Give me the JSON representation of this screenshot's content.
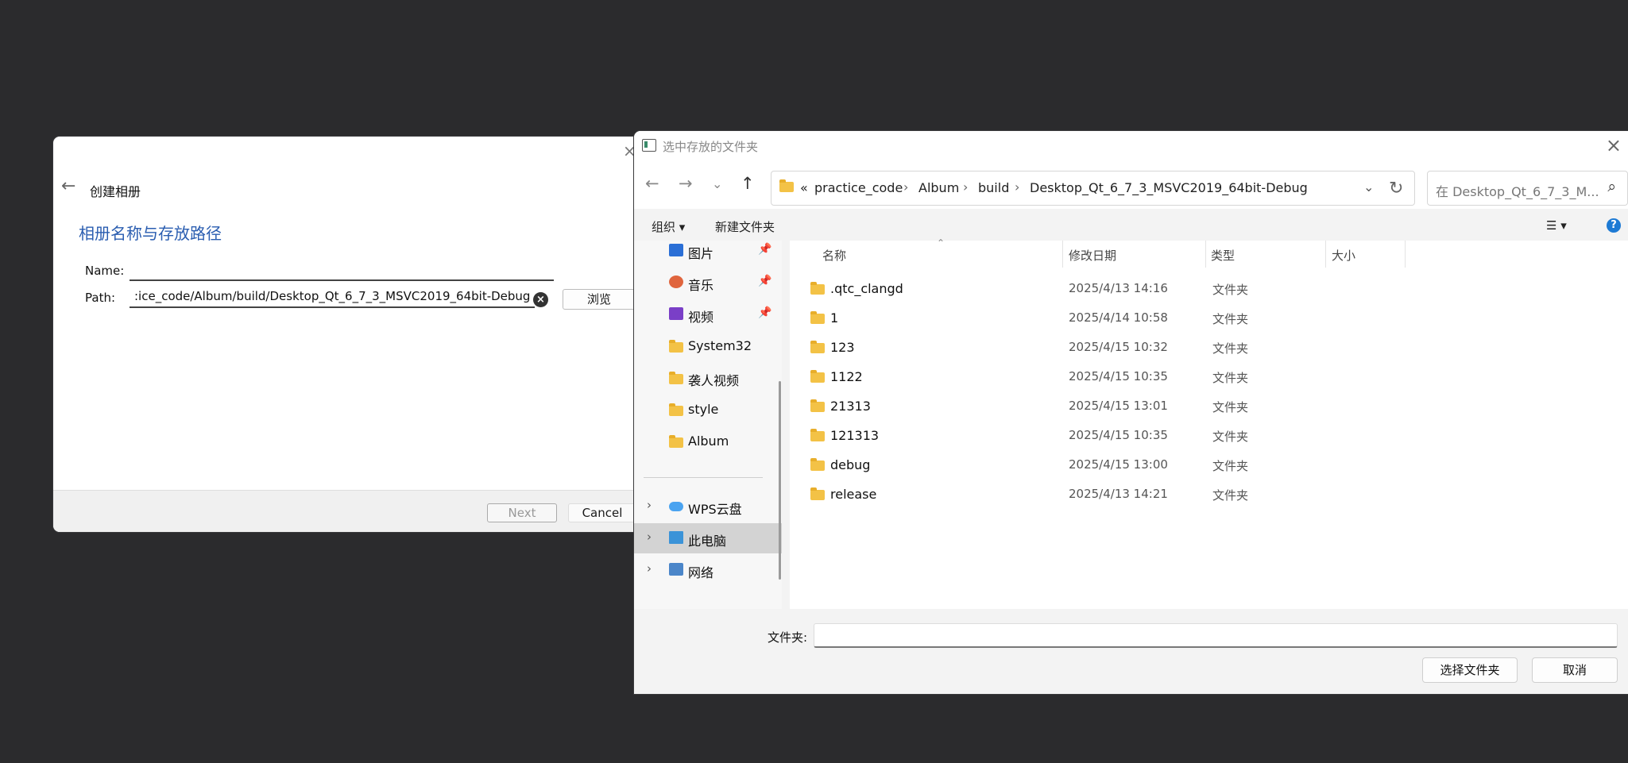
{
  "wizard": {
    "title": "创建相册",
    "heading": "相册名称与存放路径",
    "name_label": "Name:",
    "name_value": "",
    "path_label": "Path:",
    "path_value": ":ice_code/Album/build/Desktop_Qt_6_7_3_MSVC2019_64bit-Debug",
    "browse_label": "浏览",
    "next_label": "Next",
    "cancel_label": "Cancel",
    "close_glyph": "×",
    "back_glyph": "←"
  },
  "dialog": {
    "title": "选中存放的文件夹",
    "breadcrumbs": [
      "«",
      "practice_code",
      "Album",
      "build",
      "Desktop_Qt_6_7_3_MSVC2019_64bit-Debug"
    ],
    "search_placeholder": "在 Desktop_Qt_6_7_3_M...",
    "toolbar": {
      "organize": "组织 ▾",
      "new_folder": "新建文件夹",
      "view": "☰ ▾",
      "help": "?"
    },
    "sidebar": [
      {
        "label": "图片",
        "icon": "pictures-icon",
        "pinned": true
      },
      {
        "label": "音乐",
        "icon": "music-icon",
        "pinned": true
      },
      {
        "label": "视频",
        "icon": "videos-icon",
        "pinned": true
      },
      {
        "label": "System32",
        "icon": "folder-icon",
        "pinned": false
      },
      {
        "label": "袭人视频",
        "icon": "folder-icon",
        "pinned": false
      },
      {
        "label": "style",
        "icon": "folder-icon",
        "pinned": false
      },
      {
        "label": "Album",
        "icon": "folder-icon",
        "pinned": false
      }
    ],
    "sidebar_tree": [
      {
        "label": "WPS云盘",
        "icon": "cloud-icon",
        "selected": false
      },
      {
        "label": "此电脑",
        "icon": "computer-icon",
        "selected": true
      },
      {
        "label": "网络",
        "icon": "network-icon",
        "selected": false
      }
    ],
    "columns": {
      "name": "名称",
      "date": "修改日期",
      "type": "类型",
      "size": "大小"
    },
    "files": [
      {
        "name": ".qtc_clangd",
        "date": "2025/4/13 14:16",
        "type": "文件夹"
      },
      {
        "name": "1",
        "date": "2025/4/14 10:58",
        "type": "文件夹"
      },
      {
        "name": "123",
        "date": "2025/4/15 10:32",
        "type": "文件夹"
      },
      {
        "name": "1122",
        "date": "2025/4/15 10:35",
        "type": "文件夹"
      },
      {
        "name": "21313",
        "date": "2025/4/15 13:01",
        "type": "文件夹"
      },
      {
        "name": "121313",
        "date": "2025/4/15 10:35",
        "type": "文件夹"
      },
      {
        "name": "debug",
        "date": "2025/4/15 13:00",
        "type": "文件夹"
      },
      {
        "name": "release",
        "date": "2025/4/13 14:21",
        "type": "文件夹"
      }
    ],
    "folder_label": "文件夹:",
    "folder_value": "",
    "select_label": "选择文件夹",
    "cancel_label": "取消"
  },
  "colors": {
    "heading_blue": "#2a5db0",
    "folder_yellow": "#f3c246",
    "help_blue": "#1d7ad4"
  }
}
